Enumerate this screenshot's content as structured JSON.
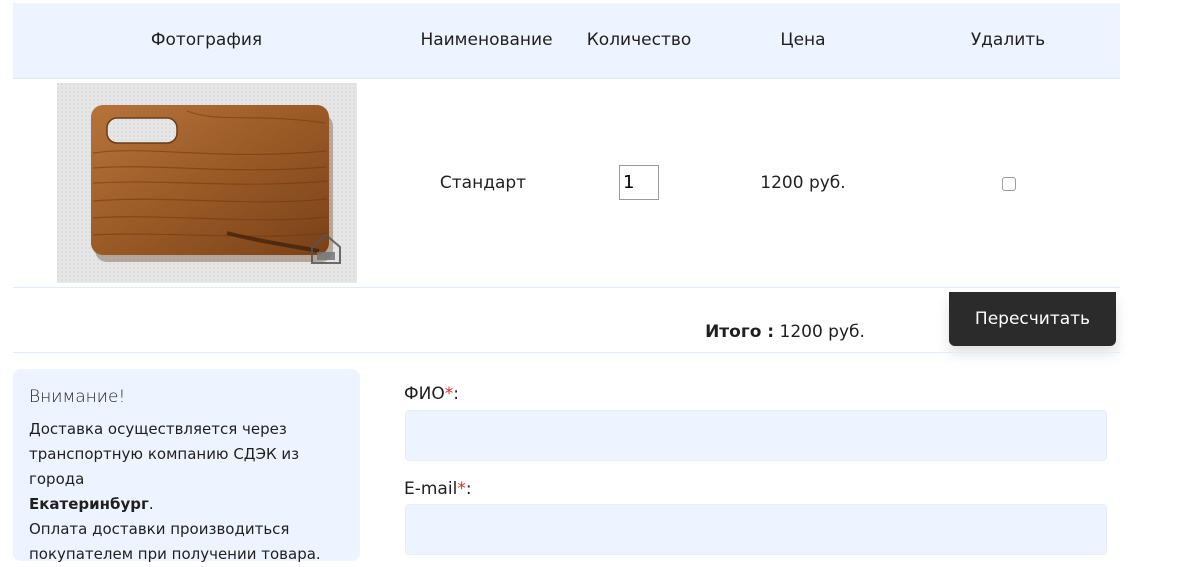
{
  "table": {
    "headers": {
      "photo": "Фотография",
      "name": "Наименование",
      "quantity": "Количество",
      "price": "Цена",
      "delete": "Удалить"
    },
    "row": {
      "name": "Стандарт",
      "quantity": "1",
      "price": "1200 руб.",
      "delete_checked": false
    }
  },
  "summary": {
    "total_label": "Итого :",
    "total_value": "1200 руб.",
    "recalc_label": "Пересчитать"
  },
  "notice": {
    "title": "Внимание!",
    "line1": "Доставка осуществляется через",
    "line2": "транспортную компанию СДЭК из города",
    "city": "Екатеринбург",
    "city_suffix": ".",
    "line4": "Оплата доставки производиться",
    "line5": "покупателем при получении товара."
  },
  "form": {
    "fio_label": "ФИО",
    "fio_value": "",
    "email_label": "E-mail",
    "email_value": "",
    "required_mark": "*",
    "label_suffix": ":"
  },
  "colors": {
    "header_bg": "#eef4ff",
    "button_bg": "#2b2b2b",
    "required": "#e22b2b"
  }
}
